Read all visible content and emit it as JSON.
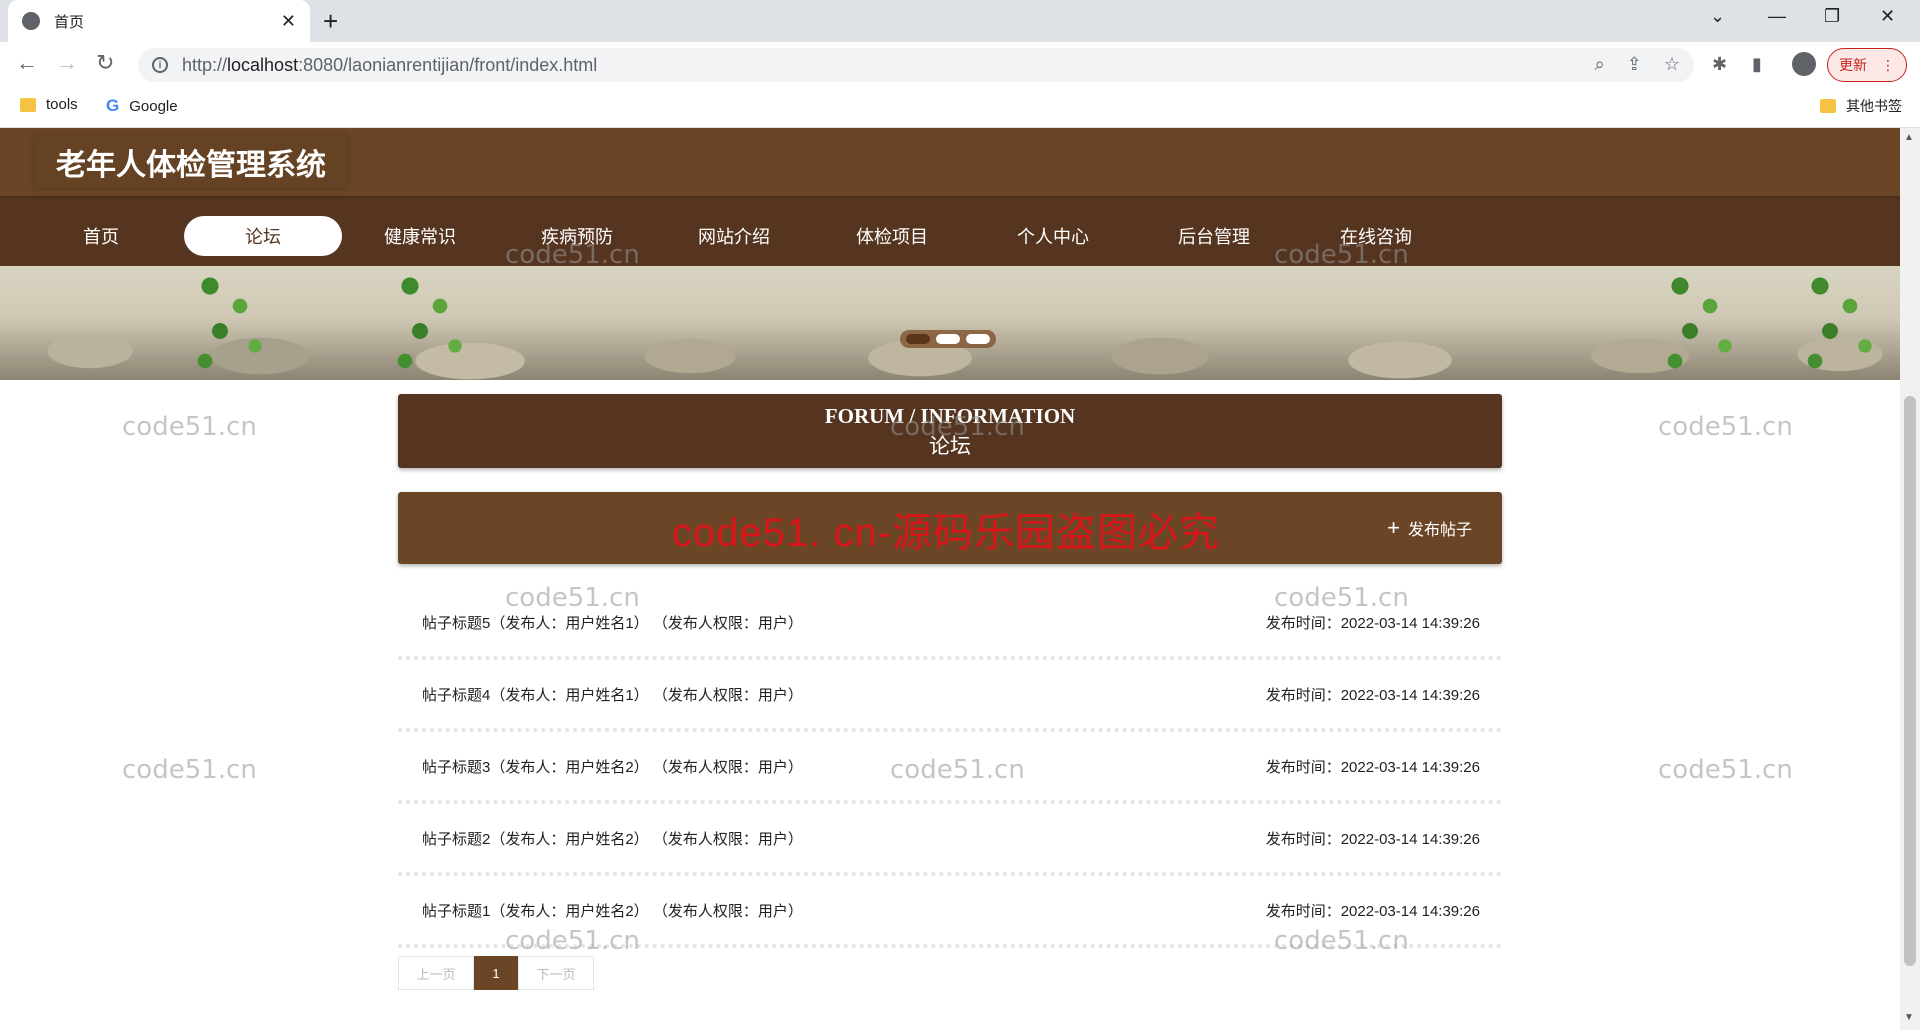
{
  "browser": {
    "tab_title": "首页",
    "url_prefix": "http://",
    "url_host": "localhost",
    "url_rest": ":8080/laonianrentijian/front/index.html",
    "update_label": "更新",
    "bookmarks": [
      "tools",
      "Google"
    ],
    "other_bookmarks": "其他书签"
  },
  "site": {
    "title": "老年人体检管理系统",
    "nav": [
      "首页",
      "论坛",
      "健康常识",
      "疾病预防",
      "网站介绍",
      "体检项目",
      "个人中心",
      "后台管理",
      "在线咨询"
    ],
    "active_nav": "论坛"
  },
  "section": {
    "title_en": "FORUM / INFORMATION",
    "title_zh": "论坛"
  },
  "forum": {
    "watermark": "code51. cn-源码乐园盗图必究",
    "post_button": "发布帖子",
    "posts": [
      {
        "left": "帖子标题5（发布人：用户姓名1） （发布人权限：用户）",
        "right": "发布时间：2022-03-14 14:39:26"
      },
      {
        "left": "帖子标题4（发布人：用户姓名1） （发布人权限：用户）",
        "right": "发布时间：2022-03-14 14:39:26"
      },
      {
        "left": "帖子标题3（发布人：用户姓名2） （发布人权限：用户）",
        "right": "发布时间：2022-03-14 14:39:26"
      },
      {
        "left": "帖子标题2（发布人：用户姓名2） （发布人权限：用户）",
        "right": "发布时间：2022-03-14 14:39:26"
      },
      {
        "left": "帖子标题1（发布人：用户姓名2） （发布人权限：用户）",
        "right": "发布时间：2022-03-14 14:39:26"
      }
    ]
  },
  "pagination": {
    "prev": "上一页",
    "current": "1",
    "next": "下一页"
  },
  "watermark_text": "code51.cn",
  "colors": {
    "header": "#6b4626",
    "nav": "#553520",
    "red_watermark": "#d9151a"
  }
}
